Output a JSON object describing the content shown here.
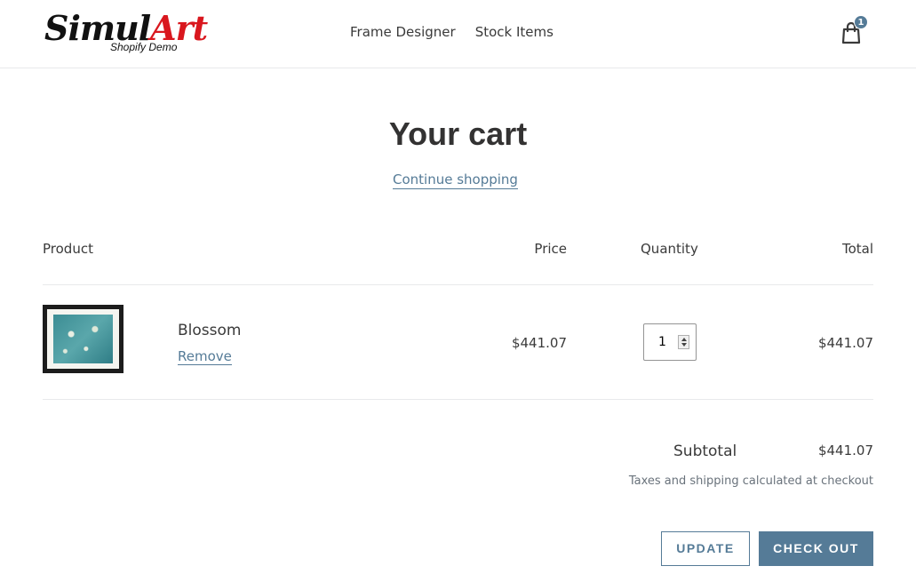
{
  "header": {
    "logo_main_part1": "Simul",
    "logo_main_part2": "Art",
    "logo_sub": "Shopify Demo",
    "nav": [
      "Frame Designer",
      "Stock Items"
    ],
    "cart_icon": "bag-icon",
    "cart_count": "1"
  },
  "page": {
    "title": "Your cart",
    "continue_link": "Continue shopping"
  },
  "table": {
    "headers": {
      "product": "Product",
      "price": "Price",
      "quantity": "Quantity",
      "total": "Total"
    },
    "items": [
      {
        "name": "Blossom",
        "remove_label": "Remove",
        "price": "$441.07",
        "quantity": "1",
        "total": "$441.07"
      }
    ]
  },
  "summary": {
    "subtotal_label": "Subtotal",
    "subtotal_value": "$441.07",
    "tax_note": "Taxes and shipping calculated at checkout"
  },
  "actions": {
    "update_label": "UPDATE",
    "checkout_label": "CHECK OUT"
  },
  "colors": {
    "accent": "#557b97",
    "logo_red": "#d9171e",
    "text": "#3a3a3a"
  }
}
